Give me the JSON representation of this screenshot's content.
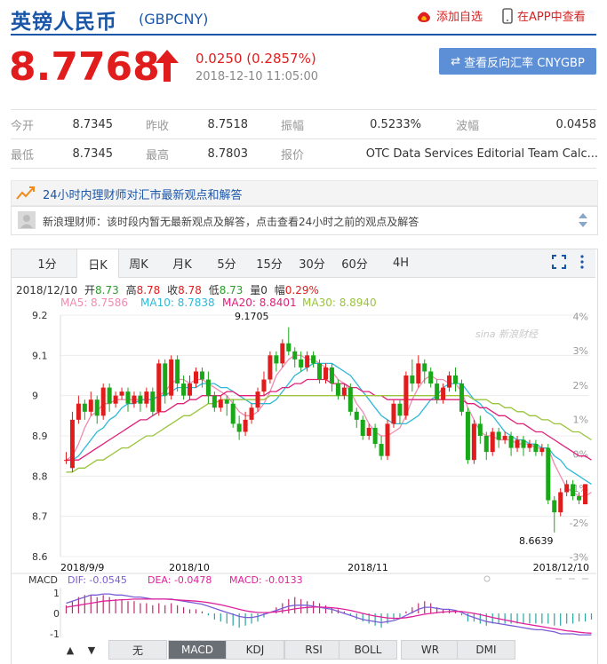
{
  "header": {
    "title": "英镑人民币",
    "code": "(GBPCNY)",
    "fav_label": "添加自选",
    "app_label": "在APP中查看"
  },
  "quote": {
    "price": "8.7768",
    "change": "0.0250 (0.2857%)",
    "time": "2018-12-10 11:05:00",
    "reverse_label": "查看反向汇率 CNYGBP",
    "up_color": "#e11c1c"
  },
  "stats": [
    [
      {
        "label": "今开",
        "value": "8.7345"
      },
      {
        "label": "昨收",
        "value": "8.7518"
      },
      {
        "label": "振幅",
        "value": "0.5233%"
      },
      {
        "label": "波幅",
        "value": "0.0458"
      }
    ],
    [
      {
        "label": "最低",
        "value": "8.7345"
      },
      {
        "label": "最高",
        "value": "8.7803"
      },
      {
        "label": "报价",
        "value": "OTC Data Services Editorial Team Calc..."
      }
    ]
  ],
  "advisor": {
    "title": "24小时内理财师对汇市最新观点和解答",
    "text": "新浪理财师：该时段内暂无最新观点及解答，点击查看24小时之前的观点及解答"
  },
  "chart_tabs": [
    "1分",
    "日K",
    "周K",
    "月K",
    "5分",
    "15分",
    "30分",
    "60分",
    "4H"
  ],
  "active_tab": "日K",
  "ohlc_line": {
    "date": "2018/12/10",
    "open_label": "开",
    "open": "8.73",
    "high_label": "高",
    "high": "8.78",
    "close_label": "收",
    "close": "8.78",
    "low_label": "低",
    "low": "8.73",
    "vol_label": "量",
    "vol": "0",
    "pct_label": "幅",
    "pct": "0.29%"
  },
  "ma_line": [
    {
      "label": "MA5: 8.7586",
      "color": "#f08cb0"
    },
    {
      "label": "MA10: 8.7838",
      "color": "#2fb8d8"
    },
    {
      "label": "MA20: 8.8401",
      "color": "#e0207a"
    },
    {
      "label": "MA30: 8.8940",
      "color": "#99c43c"
    }
  ],
  "watermark": "新浪财经",
  "macd_line": {
    "name": "MACD",
    "dif": "DIF: -0.0545",
    "dea": "DEA: -0.0478",
    "macd": "MACD: -0.0133"
  },
  "bottom_tabs": [
    "无",
    "MACD",
    "KDJ",
    "RSI",
    "BOLL",
    "WR",
    "DMI"
  ],
  "bottom_active": "MACD",
  "chart_data": {
    "type": "candlestick",
    "y_ticks": [
      "9.2",
      "9.1",
      "9",
      "8.9",
      "8.8",
      "8.7",
      "8.6"
    ],
    "y_ticks_right": [
      "4%",
      "3%",
      "2%",
      "1%",
      "0%",
      "-1%",
      "-2%",
      "-3%"
    ],
    "ylim": [
      8.6,
      9.2
    ],
    "x_labels": [
      "2018/9/9",
      "2018/10",
      "2018/11",
      "2018/12/10"
    ],
    "annotations": {
      "max": "9.1705",
      "min": "8.6639"
    },
    "macd_ticks": [
      "1",
      "0",
      "-1"
    ],
    "candles": [
      {
        "o": 8.84,
        "c": 8.84,
        "h": 8.86,
        "l": 8.83
      },
      {
        "o": 8.82,
        "c": 8.94,
        "h": 8.96,
        "l": 8.81
      },
      {
        "o": 8.94,
        "c": 8.98,
        "h": 9.0,
        "l": 8.93
      },
      {
        "o": 8.98,
        "c": 8.96,
        "h": 8.99,
        "l": 8.94
      },
      {
        "o": 8.96,
        "c": 8.99,
        "h": 9.01,
        "l": 8.95
      },
      {
        "o": 8.99,
        "c": 8.95,
        "h": 9.0,
        "l": 8.93
      },
      {
        "o": 8.95,
        "c": 9.02,
        "h": 9.03,
        "l": 8.94
      },
      {
        "o": 9.02,
        "c": 8.98,
        "h": 9.03,
        "l": 8.96
      },
      {
        "o": 8.98,
        "c": 9.0,
        "h": 9.01,
        "l": 8.97
      },
      {
        "o": 9.0,
        "c": 9.01,
        "h": 9.02,
        "l": 8.99
      },
      {
        "o": 9.01,
        "c": 8.98,
        "h": 9.02,
        "l": 8.96
      },
      {
        "o": 8.98,
        "c": 9.0,
        "h": 9.01,
        "l": 8.97
      },
      {
        "o": 9.0,
        "c": 8.98,
        "h": 9.01,
        "l": 8.96
      },
      {
        "o": 8.98,
        "c": 9.01,
        "h": 9.02,
        "l": 8.97
      },
      {
        "o": 9.01,
        "c": 8.96,
        "h": 9.02,
        "l": 8.95
      },
      {
        "o": 8.96,
        "c": 9.08,
        "h": 9.09,
        "l": 8.95
      },
      {
        "o": 9.08,
        "c": 9.0,
        "h": 9.09,
        "l": 8.98
      },
      {
        "o": 9.0,
        "c": 9.09,
        "h": 9.1,
        "l": 8.99
      },
      {
        "o": 9.09,
        "c": 9.03,
        "h": 9.1,
        "l": 9.01
      },
      {
        "o": 9.03,
        "c": 9.0,
        "h": 9.05,
        "l": 8.99
      },
      {
        "o": 9.0,
        "c": 9.03,
        "h": 9.05,
        "l": 8.99
      },
      {
        "o": 9.03,
        "c": 9.06,
        "h": 9.07,
        "l": 9.02
      },
      {
        "o": 9.06,
        "c": 9.04,
        "h": 9.07,
        "l": 9.02
      },
      {
        "o": 9.04,
        "c": 9.0,
        "h": 9.06,
        "l": 8.98
      },
      {
        "o": 9.0,
        "c": 8.97,
        "h": 9.01,
        "l": 8.96
      },
      {
        "o": 8.97,
        "c": 8.99,
        "h": 9.0,
        "l": 8.96
      },
      {
        "o": 8.99,
        "c": 8.98,
        "h": 9.0,
        "l": 8.95
      },
      {
        "o": 8.98,
        "c": 8.93,
        "h": 8.99,
        "l": 8.92
      },
      {
        "o": 8.93,
        "c": 8.91,
        "h": 8.95,
        "l": 8.89
      },
      {
        "o": 8.91,
        "c": 8.94,
        "h": 8.96,
        "l": 8.9
      },
      {
        "o": 8.94,
        "c": 8.97,
        "h": 8.98,
        "l": 8.93
      },
      {
        "o": 8.97,
        "c": 9.01,
        "h": 9.02,
        "l": 8.96
      },
      {
        "o": 9.01,
        "c": 9.04,
        "h": 9.06,
        "l": 9.0
      },
      {
        "o": 9.04,
        "c": 9.1,
        "h": 9.11,
        "l": 9.03
      },
      {
        "o": 9.1,
        "c": 9.08,
        "h": 9.11,
        "l": 9.06
      },
      {
        "o": 9.08,
        "c": 9.13,
        "h": 9.14,
        "l": 9.07
      },
      {
        "o": 9.13,
        "c": 9.11,
        "h": 9.17,
        "l": 9.1
      },
      {
        "o": 9.11,
        "c": 9.09,
        "h": 9.12,
        "l": 9.07
      },
      {
        "o": 9.09,
        "c": 9.07,
        "h": 9.11,
        "l": 9.06
      },
      {
        "o": 9.07,
        "c": 9.1,
        "h": 9.11,
        "l": 9.06
      },
      {
        "o": 9.1,
        "c": 9.08,
        "h": 9.11,
        "l": 9.07
      },
      {
        "o": 9.08,
        "c": 9.04,
        "h": 9.09,
        "l": 9.03
      },
      {
        "o": 9.04,
        "c": 9.07,
        "h": 9.08,
        "l": 9.03
      },
      {
        "o": 9.07,
        "c": 9.03,
        "h": 9.08,
        "l": 9.01
      },
      {
        "o": 9.03,
        "c": 9.0,
        "h": 9.04,
        "l": 8.99
      },
      {
        "o": 9.0,
        "c": 9.02,
        "h": 9.03,
        "l": 8.99
      },
      {
        "o": 9.02,
        "c": 8.96,
        "h": 9.03,
        "l": 8.95
      },
      {
        "o": 8.96,
        "c": 8.94,
        "h": 8.97,
        "l": 8.92
      },
      {
        "o": 8.94,
        "c": 8.9,
        "h": 8.95,
        "l": 8.89
      },
      {
        "o": 8.9,
        "c": 8.92,
        "h": 8.93,
        "l": 8.89
      },
      {
        "o": 8.92,
        "c": 8.88,
        "h": 8.93,
        "l": 8.87
      },
      {
        "o": 8.88,
        "c": 8.85,
        "h": 8.9,
        "l": 8.84
      },
      {
        "o": 8.85,
        "c": 8.93,
        "h": 8.94,
        "l": 8.84
      },
      {
        "o": 8.93,
        "c": 8.98,
        "h": 8.99,
        "l": 8.92
      },
      {
        "o": 8.98,
        "c": 8.95,
        "h": 8.99,
        "l": 8.93
      },
      {
        "o": 8.95,
        "c": 9.05,
        "h": 9.06,
        "l": 8.94
      },
      {
        "o": 9.05,
        "c": 9.03,
        "h": 9.09,
        "l": 9.01
      },
      {
        "o": 9.03,
        "c": 9.08,
        "h": 9.1,
        "l": 9.02
      },
      {
        "o": 9.08,
        "c": 9.06,
        "h": 9.09,
        "l": 9.03
      },
      {
        "o": 9.06,
        "c": 9.03,
        "h": 9.07,
        "l": 9.02
      },
      {
        "o": 9.03,
        "c": 8.99,
        "h": 9.04,
        "l": 8.98
      },
      {
        "o": 8.99,
        "c": 9.02,
        "h": 9.03,
        "l": 8.98
      },
      {
        "o": 9.02,
        "c": 9.05,
        "h": 9.06,
        "l": 9.01
      },
      {
        "o": 9.05,
        "c": 9.03,
        "h": 9.07,
        "l": 9.01
      },
      {
        "o": 9.03,
        "c": 8.96,
        "h": 9.04,
        "l": 8.95
      },
      {
        "o": 8.96,
        "c": 8.84,
        "h": 8.97,
        "l": 8.83
      },
      {
        "o": 8.84,
        "c": 8.93,
        "h": 8.94,
        "l": 8.83
      },
      {
        "o": 8.93,
        "c": 8.9,
        "h": 8.95,
        "l": 8.88
      },
      {
        "o": 8.9,
        "c": 8.86,
        "h": 8.91,
        "l": 8.84
      },
      {
        "o": 8.86,
        "c": 8.91,
        "h": 8.92,
        "l": 8.85
      },
      {
        "o": 8.91,
        "c": 8.89,
        "h": 8.92,
        "l": 8.87
      },
      {
        "o": 8.89,
        "c": 8.9,
        "h": 8.91,
        "l": 8.88
      },
      {
        "o": 8.9,
        "c": 8.87,
        "h": 8.91,
        "l": 8.85
      },
      {
        "o": 8.87,
        "c": 8.89,
        "h": 8.9,
        "l": 8.86
      },
      {
        "o": 8.89,
        "c": 8.87,
        "h": 8.9,
        "l": 8.85
      },
      {
        "o": 8.87,
        "c": 8.88,
        "h": 8.89,
        "l": 8.86
      },
      {
        "o": 8.88,
        "c": 8.86,
        "h": 8.89,
        "l": 8.85
      },
      {
        "o": 8.86,
        "c": 8.87,
        "h": 8.88,
        "l": 8.85
      },
      {
        "o": 8.87,
        "c": 8.74,
        "h": 8.88,
        "l": 8.73
      },
      {
        "o": 8.74,
        "c": 8.71,
        "h": 8.75,
        "l": 8.66
      },
      {
        "o": 8.71,
        "c": 8.76,
        "h": 8.77,
        "l": 8.7
      },
      {
        "o": 8.76,
        "c": 8.78,
        "h": 8.79,
        "l": 8.75
      },
      {
        "o": 8.78,
        "c": 8.75,
        "h": 8.79,
        "l": 8.74
      },
      {
        "o": 8.75,
        "c": 8.74,
        "h": 8.76,
        "l": 8.73
      },
      {
        "o": 8.73,
        "c": 8.78,
        "h": 8.78,
        "l": 8.73
      }
    ],
    "ma_series": [
      {
        "name": "MA5",
        "color": "#f08cb0",
        "values": [
          8.84,
          8.85,
          8.88,
          8.92,
          8.95,
          8.96,
          8.98,
          8.98,
          8.99,
          8.99,
          8.99,
          8.99,
          8.99,
          8.99,
          8.99,
          9.0,
          9.01,
          9.03,
          9.04,
          9.04,
          9.03,
          9.04,
          9.04,
          9.03,
          9.02,
          9.01,
          9.0,
          8.98,
          8.96,
          8.95,
          8.95,
          8.96,
          8.98,
          9.01,
          9.05,
          9.07,
          9.09,
          9.1,
          9.1,
          9.09,
          9.09,
          9.08,
          9.07,
          9.06,
          9.04,
          9.03,
          9.01,
          8.98,
          8.96,
          8.93,
          8.91,
          8.9,
          8.9,
          8.91,
          8.92,
          8.95,
          8.99,
          9.02,
          9.04,
          9.05,
          9.04,
          9.04,
          9.03,
          9.03,
          9.01,
          8.97,
          8.94,
          8.91,
          8.9,
          8.9,
          8.89,
          8.89,
          8.89,
          8.88,
          8.88,
          8.88,
          8.87,
          8.87,
          8.87,
          8.83,
          8.8,
          8.77,
          8.76,
          8.75,
          8.75,
          8.76
        ]
      },
      {
        "name": "MA10",
        "color": "#2fb8d8",
        "values": [
          8.84,
          8.84,
          8.85,
          8.87,
          8.89,
          8.91,
          8.92,
          8.94,
          8.95,
          8.97,
          8.98,
          8.98,
          8.99,
          8.99,
          8.99,
          9.0,
          9.0,
          9.01,
          9.02,
          9.02,
          9.02,
          9.02,
          9.03,
          9.03,
          9.03,
          9.02,
          9.02,
          9.01,
          9.0,
          8.99,
          8.98,
          8.98,
          8.98,
          8.98,
          8.99,
          9.01,
          9.03,
          9.05,
          9.06,
          9.07,
          9.08,
          9.08,
          9.08,
          9.08,
          9.07,
          9.06,
          9.05,
          9.03,
          9.01,
          8.99,
          8.97,
          8.95,
          8.94,
          8.93,
          8.93,
          8.93,
          8.94,
          8.95,
          8.97,
          8.99,
          9.0,
          9.02,
          9.03,
          9.03,
          9.03,
          9.01,
          8.99,
          8.98,
          8.96,
          8.95,
          8.93,
          8.91,
          8.9,
          8.89,
          8.89,
          8.88,
          8.88,
          8.87,
          8.87,
          8.85,
          8.84,
          8.82,
          8.81,
          8.8,
          8.79,
          8.78
        ]
      },
      {
        "name": "MA20",
        "color": "#e0207a",
        "values": [
          8.84,
          8.84,
          8.84,
          8.85,
          8.86,
          8.87,
          8.88,
          8.89,
          8.9,
          8.91,
          8.92,
          8.93,
          8.94,
          8.94,
          8.95,
          8.96,
          8.96,
          8.97,
          8.98,
          8.98,
          8.99,
          8.99,
          9.0,
          9.0,
          9.0,
          9.0,
          9.01,
          9.01,
          9.0,
          9.0,
          9.0,
          9.0,
          9.0,
          9.01,
          9.01,
          9.02,
          9.02,
          9.03,
          9.03,
          9.04,
          9.04,
          9.04,
          9.04,
          9.03,
          9.03,
          9.03,
          9.02,
          9.02,
          9.01,
          9.01,
          9.0,
          9.0,
          8.99,
          8.99,
          8.99,
          8.99,
          8.99,
          8.99,
          8.99,
          8.99,
          8.99,
          8.99,
          8.99,
          8.99,
          8.99,
          8.98,
          8.98,
          8.97,
          8.97,
          8.96,
          8.95,
          8.95,
          8.94,
          8.93,
          8.93,
          8.92,
          8.91,
          8.91,
          8.9,
          8.89,
          8.88,
          8.87,
          8.86,
          8.85,
          8.85,
          8.84
        ]
      },
      {
        "name": "MA30",
        "color": "#99c43c",
        "values": [
          8.81,
          8.81,
          8.82,
          8.82,
          8.83,
          8.84,
          8.84,
          8.85,
          8.86,
          8.87,
          8.87,
          8.88,
          8.89,
          8.9,
          8.9,
          8.91,
          8.92,
          8.93,
          8.94,
          8.95,
          8.95,
          8.96,
          8.97,
          8.98,
          8.98,
          8.99,
          8.99,
          8.99,
          8.99,
          8.99,
          8.99,
          8.99,
          8.99,
          9.0,
          9.0,
          9.0,
          9.0,
          9.0,
          9.0,
          9.0,
          9.0,
          9.0,
          9.0,
          9.0,
          9.0,
          9.0,
          9.0,
          9.0,
          9.0,
          9.0,
          9.0,
          9.0,
          9.0,
          9.0,
          9.0,
          9.0,
          9.0,
          9.0,
          9.0,
          9.0,
          9.0,
          9.0,
          9.0,
          9.0,
          9.0,
          9.0,
          8.99,
          8.99,
          8.99,
          8.98,
          8.98,
          8.97,
          8.97,
          8.96,
          8.96,
          8.95,
          8.95,
          8.94,
          8.94,
          8.93,
          8.93,
          8.92,
          8.91,
          8.91,
          8.9,
          8.89
        ]
      }
    ],
    "macd_hist": [
      0.4,
      0.6,
      0.8,
      0.9,
      0.9,
      0.8,
      0.9,
      0.8,
      0.7,
      0.7,
      0.6,
      0.6,
      0.5,
      0.5,
      0.4,
      0.5,
      0.4,
      0.5,
      0.4,
      0.3,
      0.2,
      0.2,
      0.1,
      -0.1,
      -0.3,
      -0.4,
      -0.5,
      -0.6,
      -0.7,
      -0.6,
      -0.5,
      -0.4,
      -0.2,
      0.0,
      0.3,
      0.5,
      0.7,
      0.8,
      0.7,
      0.6,
      0.6,
      0.5,
      0.4,
      0.3,
      0.2,
      0.1,
      -0.1,
      -0.3,
      -0.4,
      -0.5,
      -0.6,
      -0.7,
      -0.5,
      -0.3,
      -0.2,
      0.1,
      0.3,
      0.5,
      0.6,
      0.5,
      0.3,
      0.2,
      0.2,
      0.1,
      -0.1,
      -0.4,
      -0.4,
      -0.5,
      -0.6,
      -0.5,
      -0.5,
      -0.5,
      -0.5,
      -0.5,
      -0.5,
      -0.5,
      -0.5,
      -0.5,
      -0.5,
      -0.6,
      -0.6,
      -0.5,
      -0.5,
      -0.4,
      -0.4,
      -0.3
    ],
    "dif_values": [
      0.5,
      0.6,
      0.7,
      0.8,
      0.9,
      0.9,
      0.95,
      0.95,
      0.9,
      0.9,
      0.85,
      0.8,
      0.8,
      0.75,
      0.7,
      0.7,
      0.7,
      0.7,
      0.65,
      0.6,
      0.55,
      0.5,
      0.45,
      0.35,
      0.25,
      0.15,
      0.05,
      -0.05,
      -0.15,
      -0.2,
      -0.2,
      -0.15,
      -0.05,
      0.05,
      0.15,
      0.25,
      0.35,
      0.4,
      0.4,
      0.4,
      0.35,
      0.3,
      0.25,
      0.2,
      0.1,
      0.0,
      -0.1,
      -0.2,
      -0.3,
      -0.35,
      -0.4,
      -0.45,
      -0.4,
      -0.35,
      -0.25,
      -0.1,
      0.05,
      0.2,
      0.3,
      0.3,
      0.25,
      0.2,
      0.2,
      0.15,
      0.05,
      -0.1,
      -0.2,
      -0.3,
      -0.4,
      -0.45,
      -0.5,
      -0.55,
      -0.6,
      -0.65,
      -0.7,
      -0.75,
      -0.8,
      -0.8,
      -0.85,
      -0.9,
      -1.0,
      -1.0,
      -1.0,
      -1.05,
      -1.05,
      -1.05
    ],
    "dea_values": [
      0.3,
      0.35,
      0.4,
      0.45,
      0.5,
      0.55,
      0.6,
      0.62,
      0.65,
      0.67,
      0.68,
      0.7,
      0.7,
      0.7,
      0.7,
      0.7,
      0.7,
      0.68,
      0.66,
      0.64,
      0.62,
      0.6,
      0.57,
      0.53,
      0.48,
      0.42,
      0.35,
      0.28,
      0.2,
      0.13,
      0.08,
      0.05,
      0.04,
      0.05,
      0.08,
      0.12,
      0.17,
      0.22,
      0.26,
      0.29,
      0.31,
      0.31,
      0.3,
      0.28,
      0.25,
      0.2,
      0.15,
      0.08,
      0.0,
      -0.07,
      -0.13,
      -0.18,
      -0.22,
      -0.24,
      -0.24,
      -0.21,
      -0.16,
      -0.1,
      -0.04,
      0.0,
      0.04,
      0.07,
      0.09,
      0.1,
      0.09,
      0.05,
      0.0,
      -0.06,
      -0.13,
      -0.2,
      -0.26,
      -0.32,
      -0.38,
      -0.44,
      -0.5,
      -0.55,
      -0.6,
      -0.65,
      -0.7,
      -0.75,
      -0.8,
      -0.85,
      -0.88,
      -0.92,
      -0.95,
      -0.97
    ]
  }
}
